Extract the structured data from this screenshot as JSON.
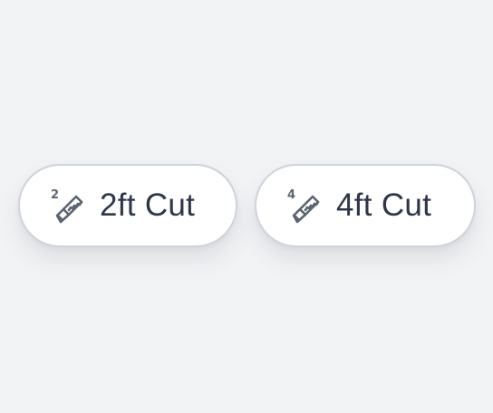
{
  "buttons": [
    {
      "label": "2ft Cut",
      "icon": "saw-icon",
      "icon_number": "2"
    },
    {
      "label": "4ft Cut",
      "icon": "saw-icon",
      "icon_number": "4"
    }
  ],
  "colors": {
    "background": "#f2f3f5",
    "button_bg": "#ffffff",
    "button_border": "#cfd3da",
    "text": "#2e3648",
    "icon": "#5b6472"
  }
}
